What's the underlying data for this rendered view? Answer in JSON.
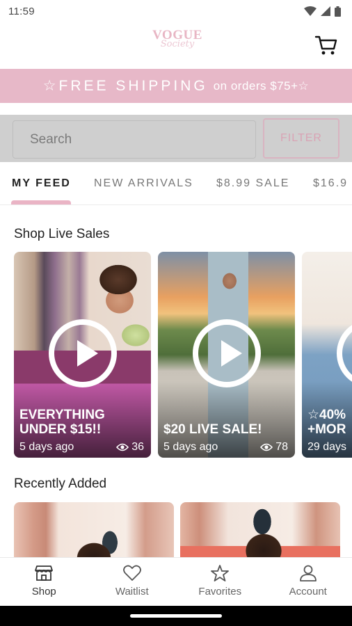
{
  "status": {
    "time": "11:59"
  },
  "brand": {
    "name": "VOGUE",
    "tagline": "Society"
  },
  "promo": {
    "main": "☆FREE SHIPPING",
    "suffix": "on orders $75+☆"
  },
  "search": {
    "placeholder": "Search",
    "filter_label": "FILTER"
  },
  "tabs": [
    {
      "label": "MY FEED",
      "active": true
    },
    {
      "label": "NEW ARRIVALS",
      "active": false
    },
    {
      "label": "$8.99 SALE",
      "active": false
    },
    {
      "label": "$16.9",
      "active": false
    }
  ],
  "live_sales": {
    "title": "Shop Live Sales",
    "items": [
      {
        "title": "EVERYTHING\nUNDER $15!!",
        "age": "5 days ago",
        "views": "36"
      },
      {
        "title": "$20 LIVE SALE!",
        "age": "5 days ago",
        "views": "78"
      },
      {
        "title": "☆40%\n+MOR",
        "age": "29 days",
        "views": ""
      }
    ]
  },
  "recently_added": {
    "title": "Recently Added"
  },
  "bottom_nav": [
    {
      "label": "Shop",
      "icon": "shop-icon",
      "active": true
    },
    {
      "label": "Waitlist",
      "icon": "heart-icon",
      "active": false
    },
    {
      "label": "Favorites",
      "icon": "star-icon",
      "active": false
    },
    {
      "label": "Account",
      "icon": "person-icon",
      "active": false
    }
  ],
  "colors": {
    "accent_pink": "#e7b8c8",
    "logo_pink": "#e8b6c4",
    "filter_pink": "#d9a3b4"
  }
}
